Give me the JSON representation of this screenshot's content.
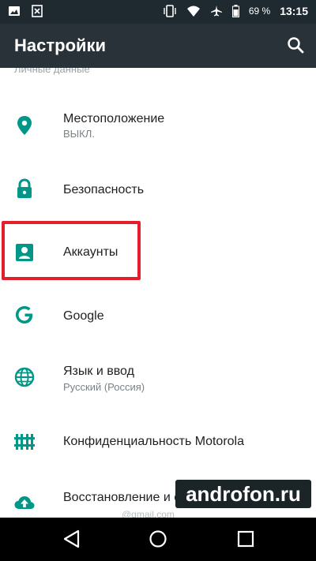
{
  "status_bar": {
    "battery": "69 %",
    "time": "13:15",
    "icons": [
      "image-icon",
      "close-box-icon",
      "vibrate-icon",
      "wifi-icon",
      "airplane-icon",
      "battery-icon"
    ]
  },
  "app_bar": {
    "title": "Настройки",
    "search_icon": "search-icon"
  },
  "list": {
    "section_label": "Личные данные",
    "items": [
      {
        "label": "Местоположение",
        "subtitle": "ВЫКЛ.",
        "icon": "location-icon"
      },
      {
        "label": "Безопасность",
        "subtitle": "",
        "icon": "lock-icon"
      },
      {
        "label": "Аккаунты",
        "subtitle": "",
        "icon": "account-icon"
      },
      {
        "label": "Google",
        "subtitle": "",
        "icon": "google-icon"
      },
      {
        "label": "Язык и ввод",
        "subtitle": "Русский (Россия)",
        "icon": "globe-icon"
      },
      {
        "label": "Конфиденциальность Motorola",
        "subtitle": "",
        "icon": "privacy-icon"
      },
      {
        "label": "Восстановление и сброс",
        "subtitle": "",
        "icon": "cloud-upload-icon"
      }
    ]
  },
  "overlay": {
    "watermark": "androfon.ru",
    "faint_text": "@gmail.com"
  },
  "nav_bar": {
    "back": "back-icon",
    "home": "home-icon",
    "recents": "recents-icon"
  },
  "colors": {
    "app_bar": "#283238",
    "status_bar": "#1f2a30",
    "accent": "#009688",
    "highlight": "#e51e2b"
  }
}
